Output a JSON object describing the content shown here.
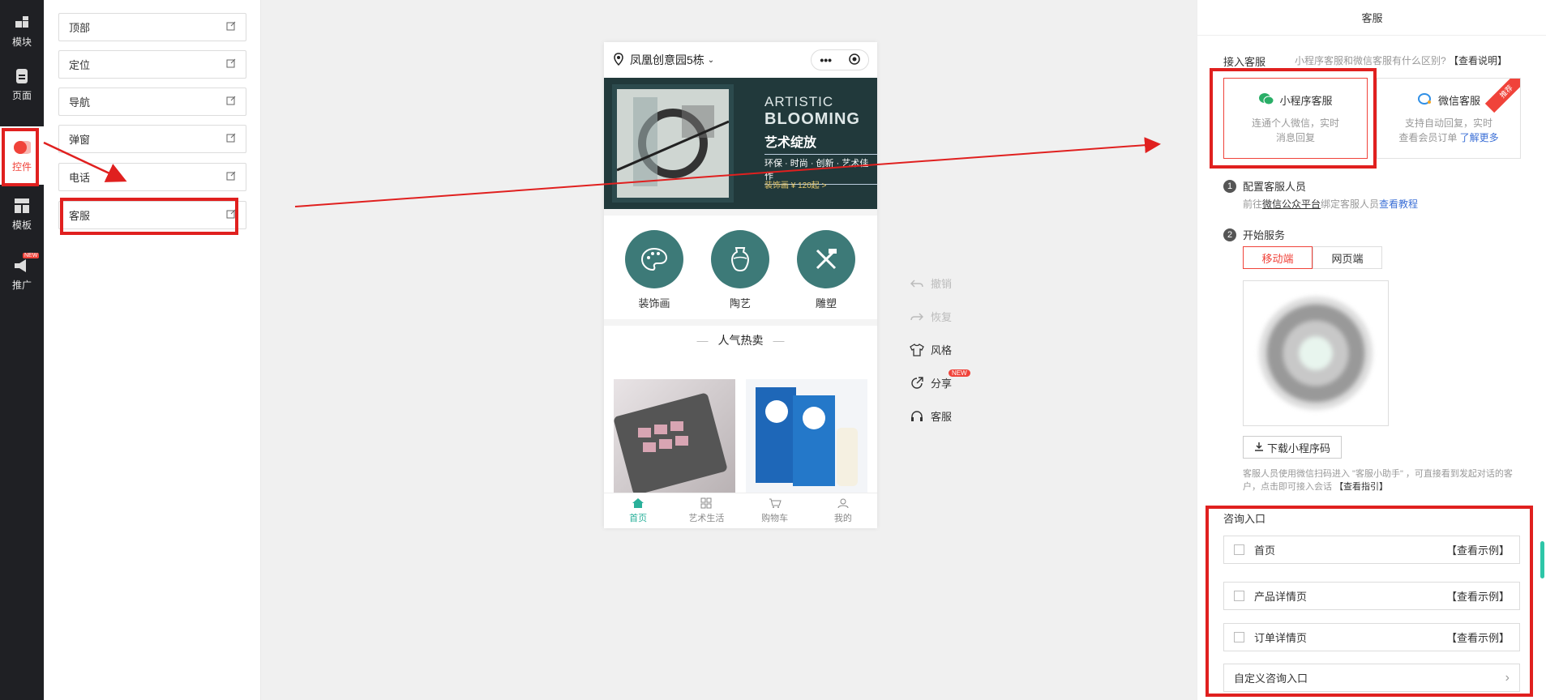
{
  "iconbar": {
    "items": [
      {
        "label": "模块",
        "icon": "module-icon"
      },
      {
        "label": "页面",
        "icon": "page-icon"
      },
      {
        "label": "控件",
        "icon": "widget-icon"
      },
      {
        "label": "模板",
        "icon": "template-icon"
      },
      {
        "label": "推广",
        "icon": "promotion-icon"
      }
    ],
    "new_badge": "NEW"
  },
  "widgets": {
    "items": [
      "顶部",
      "定位",
      "导航",
      "弹窗",
      "电话",
      "客服"
    ]
  },
  "phone": {
    "location": "凤凰创意园5栋",
    "capsule_more": "•••",
    "banner": {
      "line1": "ARTISTIC",
      "line2": "BLOOMING",
      "line3": "艺术绽放",
      "line4": "环保 · 时尚 · 创新 · 艺术佳作",
      "line5": "装饰画 ¥ 120起 >"
    },
    "categories": [
      "装饰画",
      "陶艺",
      "雕塑"
    ],
    "hot_title": "人气热卖",
    "tabs": [
      "首页",
      "艺术生活",
      "购物车",
      "我的"
    ]
  },
  "tools": {
    "items": [
      "撤销",
      "恢复",
      "风格",
      "分享",
      "客服"
    ],
    "share_badge": "NEW"
  },
  "right": {
    "title": "客服",
    "access_label": "接入客服",
    "diff_question": "小程序客服和微信客服有什么区别?",
    "diff_link": "【查看说明】",
    "card_mini": {
      "title": "小程序客服",
      "desc1": "连通个人微信，实时",
      "desc2": "消息回复"
    },
    "card_wechat": {
      "title": "微信客服",
      "desc1": "支持自动回复，实时",
      "desc2": "查看会员订单",
      "link": "了解更多"
    },
    "ribbon": "推荐",
    "step1": {
      "num": "1",
      "title": "配置客服人员",
      "pre": "前往",
      "link1": "微信公众平台",
      "mid": "绑定客服人员",
      "link2": "查看教程"
    },
    "step2": {
      "num": "2",
      "title": "开始服务"
    },
    "seg_mobile": "移动端",
    "seg_web": "网页端",
    "download": "下载小程序码",
    "note": "客服人员使用微信扫码进入 \"客服小助手\" ，可直接看到发起对话的客户，点击即可接入会话",
    "note_link": "【查看指引】",
    "entry_title": "咨询入口",
    "entries": [
      {
        "label": "首页",
        "example": "【查看示例】"
      },
      {
        "label": "产品详情页",
        "example": "【查看示例】"
      },
      {
        "label": "订单详情页",
        "example": "【查看示例】"
      }
    ],
    "custom_entry": "自定义咨询入口",
    "custom_arrow": "›"
  },
  "colors": {
    "accent_red": "#e0201f",
    "green": "#2ab09a",
    "sidebar": "#1f2024"
  }
}
